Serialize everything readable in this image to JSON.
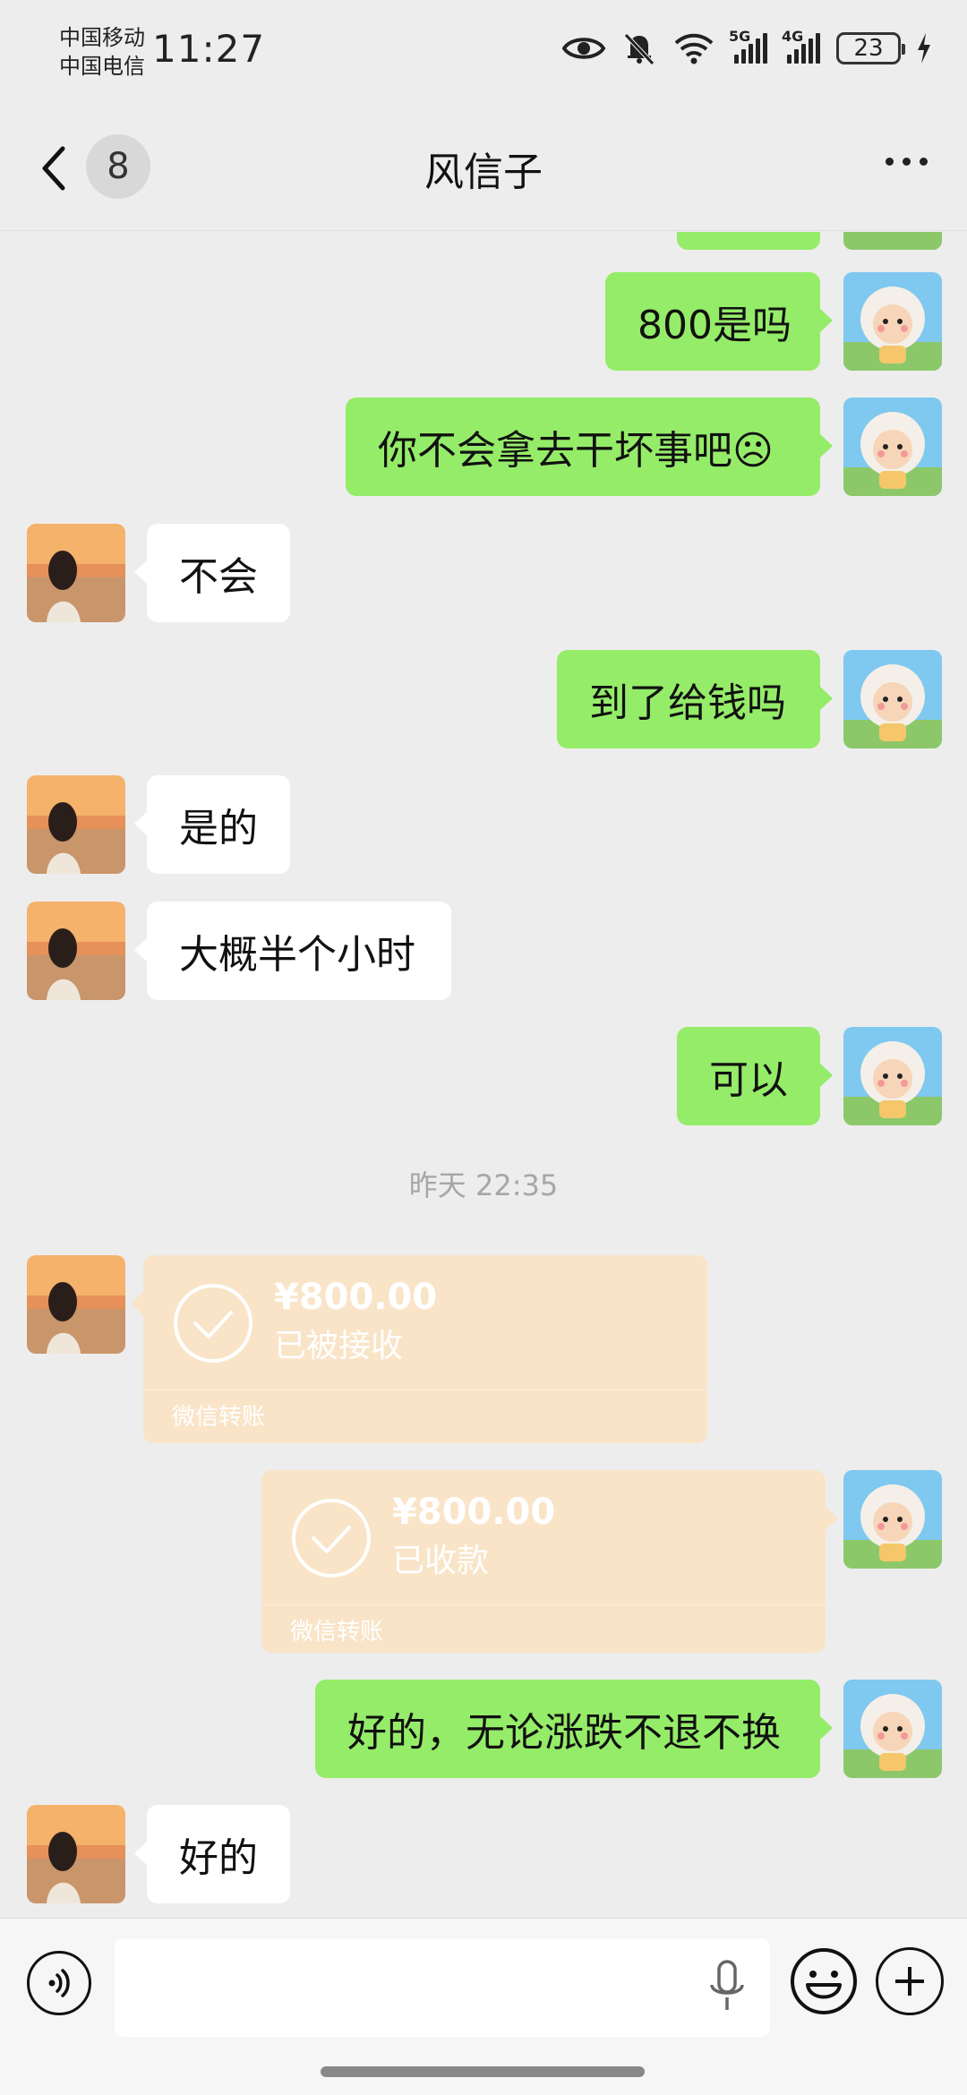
{
  "status_bar": {
    "carrier_1": "中国移动",
    "carrier_2": "中国电信",
    "time": "11:27",
    "network_1": "5G",
    "network_2": "4G",
    "battery": "23"
  },
  "header": {
    "unread_count": "8",
    "title": "风信子"
  },
  "messages": [
    {
      "id": 1,
      "side": "out",
      "text": "800是吗"
    },
    {
      "id": 2,
      "side": "out",
      "text": "你不会拿去干坏事吧☹"
    },
    {
      "id": 3,
      "side": "in",
      "text": "不会"
    },
    {
      "id": 4,
      "side": "out",
      "text": "到了给钱吗"
    },
    {
      "id": 5,
      "side": "in",
      "text": "是的"
    },
    {
      "id": 6,
      "side": "in",
      "text": "大概半个小时"
    },
    {
      "id": 7,
      "side": "out",
      "text": "可以"
    },
    {
      "id": 8,
      "side": "out",
      "text": "好的，无论涨跌不退不换"
    },
    {
      "id": 9,
      "side": "in",
      "text": "好的"
    }
  ],
  "timestamp": "昨天 22:35",
  "transfers": [
    {
      "side": "in",
      "amount": "¥800.00",
      "status": "已被接收",
      "footer": "微信转账"
    },
    {
      "side": "out",
      "amount": "¥800.00",
      "status": "已收款",
      "footer": "微信转账"
    }
  ],
  "colors": {
    "background": "#ededed",
    "outgoing_bubble": "#95ec69",
    "incoming_bubble": "#ffffff",
    "transfer_card": "#f9e4c8"
  }
}
